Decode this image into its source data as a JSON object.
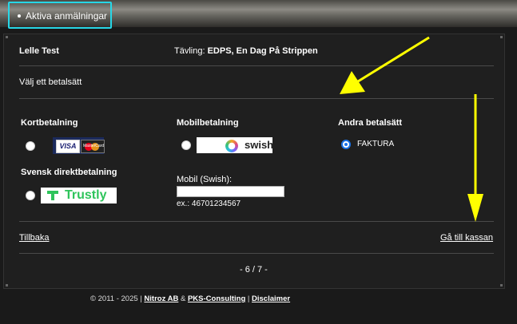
{
  "header": {
    "tab_label": "Aktiva anmälningar"
  },
  "registration": {
    "name": "Lelle Test",
    "competition_label": "Tävling:",
    "competition_name": "EDPS, En Dag På Strippen"
  },
  "payment": {
    "choose_label": "Välj ett betalsätt",
    "card": {
      "title": "Kortbetalning",
      "visa": "VISA",
      "mastercard": "MasterCard",
      "selected": false
    },
    "mobile": {
      "title": "Mobilbetalning",
      "logo": "swish",
      "selected": false
    },
    "other": {
      "title": "Andra betalsätt",
      "option": "FAKTURA",
      "selected": true
    },
    "direct": {
      "title": "Svensk direktbetalning",
      "logo": "Trustly",
      "selected": false
    },
    "mobile_field": {
      "label": "Mobil (Swish):",
      "value": "",
      "example": "ex.: 46701234567"
    }
  },
  "nav": {
    "back": "Tillbaka",
    "checkout": "Gå till kassan",
    "page": "- 6 / 7 -"
  },
  "footer": {
    "copyright": "© 2011 - 2025 |",
    "company1": "Nitroz AB",
    "amp": "&",
    "company2": "PKS-Consulting",
    "sep": "|",
    "disclaimer": "Disclaimer"
  },
  "colors": {
    "highlight_box": "#27d6e6",
    "annotation_arrow": "#ffff00",
    "trustly_green": "#2ec45b",
    "radio_selected": "#1a73e8"
  }
}
